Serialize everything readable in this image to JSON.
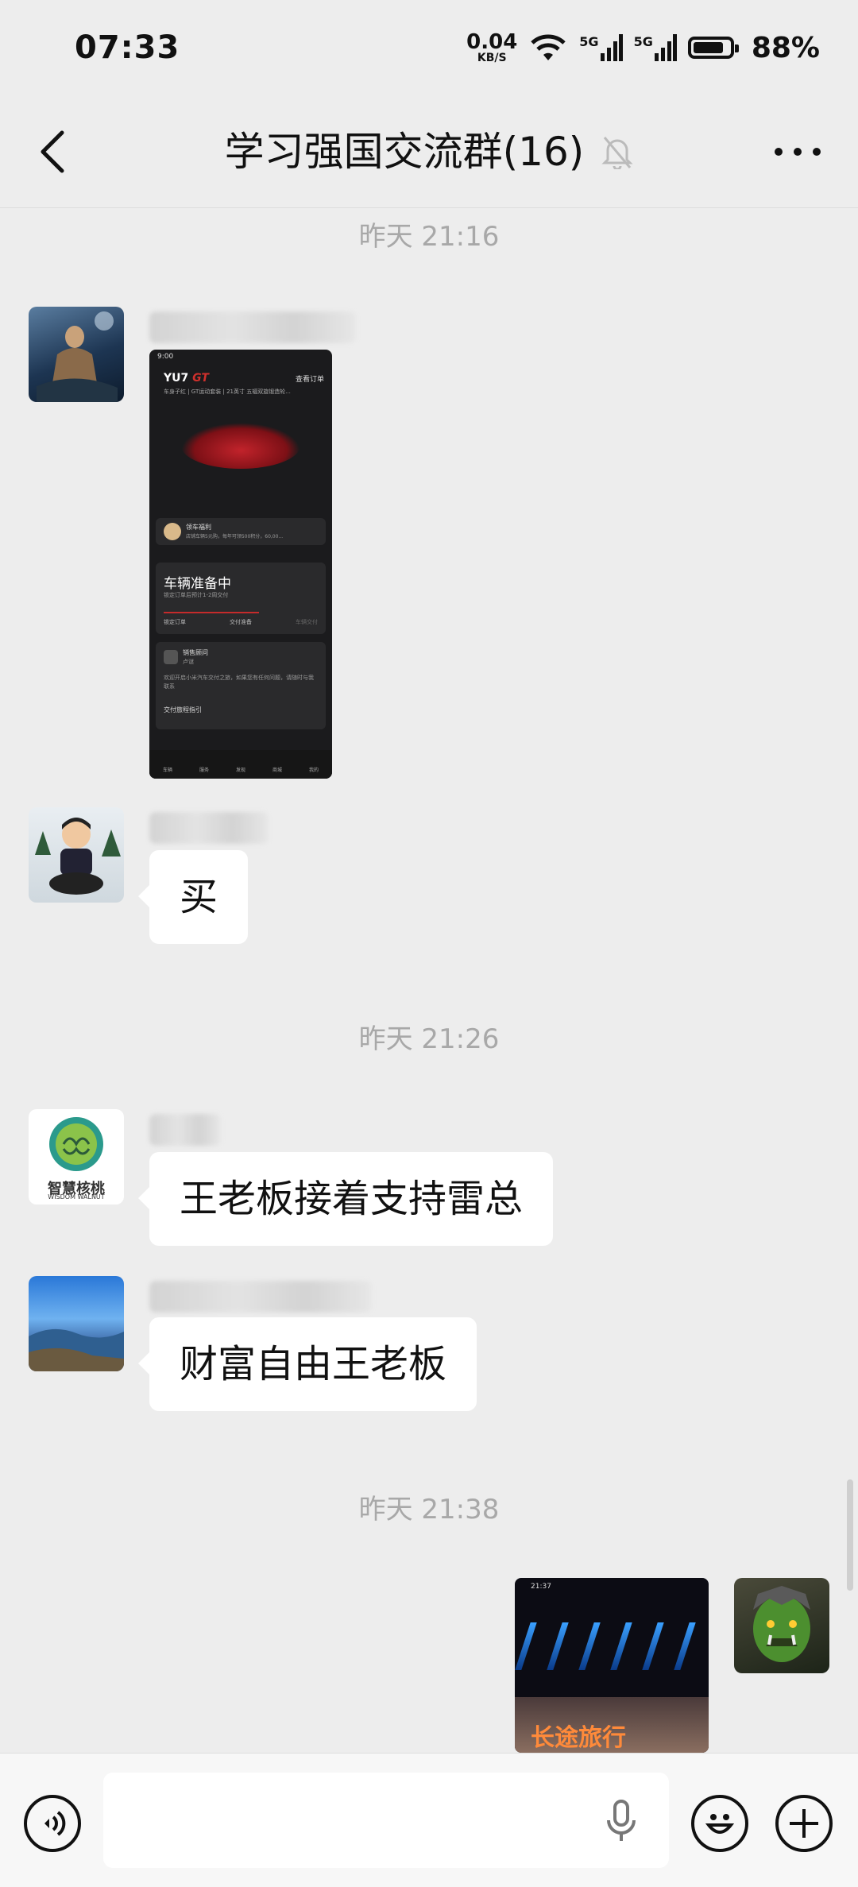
{
  "status_bar": {
    "time": "07:33",
    "net_speed": "0.04",
    "net_unit": "KB/S",
    "signal1": "5G",
    "signal2": "5G",
    "battery": "88%"
  },
  "header": {
    "title": "学习强国交流群(16)",
    "mute_icon": "bell-off-icon"
  },
  "timestamps": [
    "昨天 21:16",
    "昨天 21:26",
    "昨天 21:38"
  ],
  "messages": [
    {
      "type": "image",
      "caption": "车辆准备中",
      "brand": "YU7"
    },
    {
      "type": "text",
      "text": "买"
    },
    {
      "type": "text",
      "text": "王老板接着支持雷总"
    },
    {
      "type": "text",
      "text": "财富自由王老板"
    },
    {
      "type": "image",
      "caption": "长途旅行",
      "self": true
    }
  ],
  "shot1": {
    "status_time": "9:00",
    "brand": "YU7",
    "brand_suffix": "GT",
    "link": "查看订单",
    "subtitle": "车身子红 | GT运动套装 | 21英寸 五辐双旋锻造轮...",
    "welfare": "领车福利",
    "welfare_sub": "店铺车辆5元购，每年可领500积分，60,00...",
    "prep_title": "车辆准备中",
    "prep_sub": "锁定订单后预计1-2周交付",
    "steps": [
      "锁定订单",
      "交付准备",
      "车辆交付"
    ],
    "advisor": "销售顾问",
    "advisor_name": "卢谜",
    "advisor_msg": "欢迎开启小米汽车交付之旅，如果您有任何问题，请随时与我联系",
    "guide": "交付旅程指引",
    "tabs": [
      "车辆",
      "服务",
      "发现",
      "商城",
      "我的"
    ]
  },
  "shot2": {
    "status_time": "21:37",
    "banner_text": "长途旅行"
  },
  "avatars": {
    "walnut_text": "智慧核桃",
    "walnut_sub": "WISDOM WALNUT"
  },
  "colors": {
    "background": "#ededed",
    "bubble": "#ffffff",
    "timestamp": "#a8a8a8"
  }
}
